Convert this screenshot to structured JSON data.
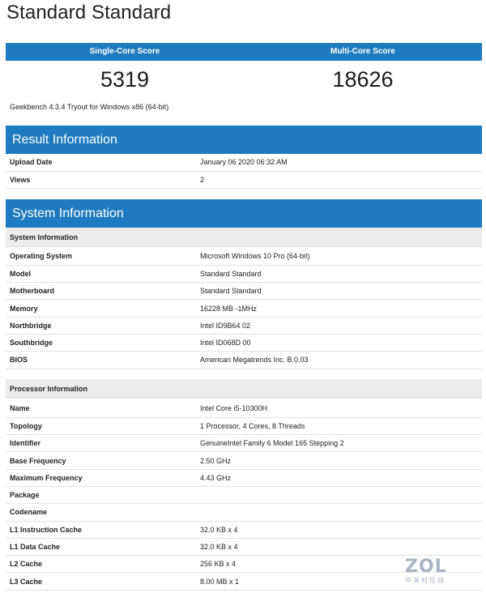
{
  "title": "Standard Standard",
  "scores": {
    "single_label": "Single-Core Score",
    "multi_label": "Multi-Core Score",
    "single_value": "5319",
    "multi_value": "18626"
  },
  "version_text": "Geekbench 4.3.4 Tryout for Windows x86 (64-bit)",
  "result_info": {
    "header": "Result Information",
    "rows": [
      {
        "key": "Upload Date",
        "value": "January 06 2020 06:32 AM"
      },
      {
        "key": "Views",
        "value": "2"
      }
    ]
  },
  "system_info": {
    "header": "System Information",
    "sub_header": "System Information",
    "rows": [
      {
        "key": "Operating System",
        "value": "Microsoft Windows 10 Pro (64-bit)"
      },
      {
        "key": "Model",
        "value": "Standard Standard"
      },
      {
        "key": "Motherboard",
        "value": "Standard Standard"
      },
      {
        "key": "Memory",
        "value": "16228 MB -1MHz"
      },
      {
        "key": "Northbridge",
        "value": "Intel ID9B64 02"
      },
      {
        "key": "Southbridge",
        "value": "Intel ID068D 00"
      },
      {
        "key": "BIOS",
        "value": "American Megatrends Inc. B.0.03"
      }
    ]
  },
  "processor_info": {
    "sub_header": "Processor Information",
    "rows": [
      {
        "key": "Name",
        "value": "Intel Core i5-10300H"
      },
      {
        "key": "Topology",
        "value": "1 Processor, 4 Cores, 8 Threads"
      },
      {
        "key": "Identifier",
        "value": "GenuineIntel Family 6 Model 165 Stepping 2"
      },
      {
        "key": "Base Frequency",
        "value": "2.50 GHz"
      },
      {
        "key": "Maximum Frequency",
        "value": "4.43 GHz"
      },
      {
        "key": "Package",
        "value": ""
      },
      {
        "key": "Codename",
        "value": ""
      },
      {
        "key": "L1 Instruction Cache",
        "value": "32.0 KB x 4"
      },
      {
        "key": "L1 Data Cache",
        "value": "32.0 KB x 4"
      },
      {
        "key": "L2 Cache",
        "value": "256 KB x 4"
      },
      {
        "key": "L3 Cache",
        "value": "8.00 MB x 1"
      }
    ]
  },
  "watermark": {
    "logo": "ZOL",
    "sub": "中关村在线"
  },
  "colors": {
    "accent": "#1e7bbf",
    "subheader_bg": "#ececec"
  }
}
